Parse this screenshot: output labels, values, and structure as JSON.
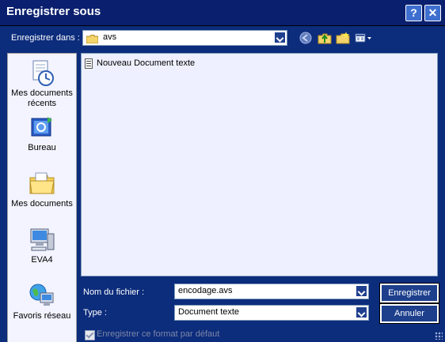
{
  "window": {
    "title": "Enregistrer sous",
    "help_label": "?",
    "close_label": "✕"
  },
  "toolbar": {
    "save_in_label": "Enregistrer dans :",
    "location_value": "avs",
    "icons": [
      "back-icon",
      "up-folder-icon",
      "new-folder-icon",
      "view-menu-icon"
    ]
  },
  "places": [
    {
      "label": "Mes documents récents",
      "icon": "recent-documents-icon"
    },
    {
      "label": "Bureau",
      "icon": "desktop-icon"
    },
    {
      "label": "Mes documents",
      "icon": "my-documents-icon"
    },
    {
      "label": "EVA4",
      "icon": "computer-icon"
    },
    {
      "label": "Favoris réseau",
      "icon": "network-places-icon"
    }
  ],
  "files": [
    {
      "name": "Nouveau Document texte",
      "icon": "text-document-icon"
    }
  ],
  "form": {
    "filename_label": "Nom du fichier :",
    "filename_value": "encodage.avs",
    "type_label": "Type :",
    "type_value": "Document texte",
    "save_button": "Enregistrer",
    "cancel_button": "Annuler",
    "default_format_label": "Enregistrer ce format par défaut",
    "default_format_checked": true,
    "default_format_enabled": false
  }
}
